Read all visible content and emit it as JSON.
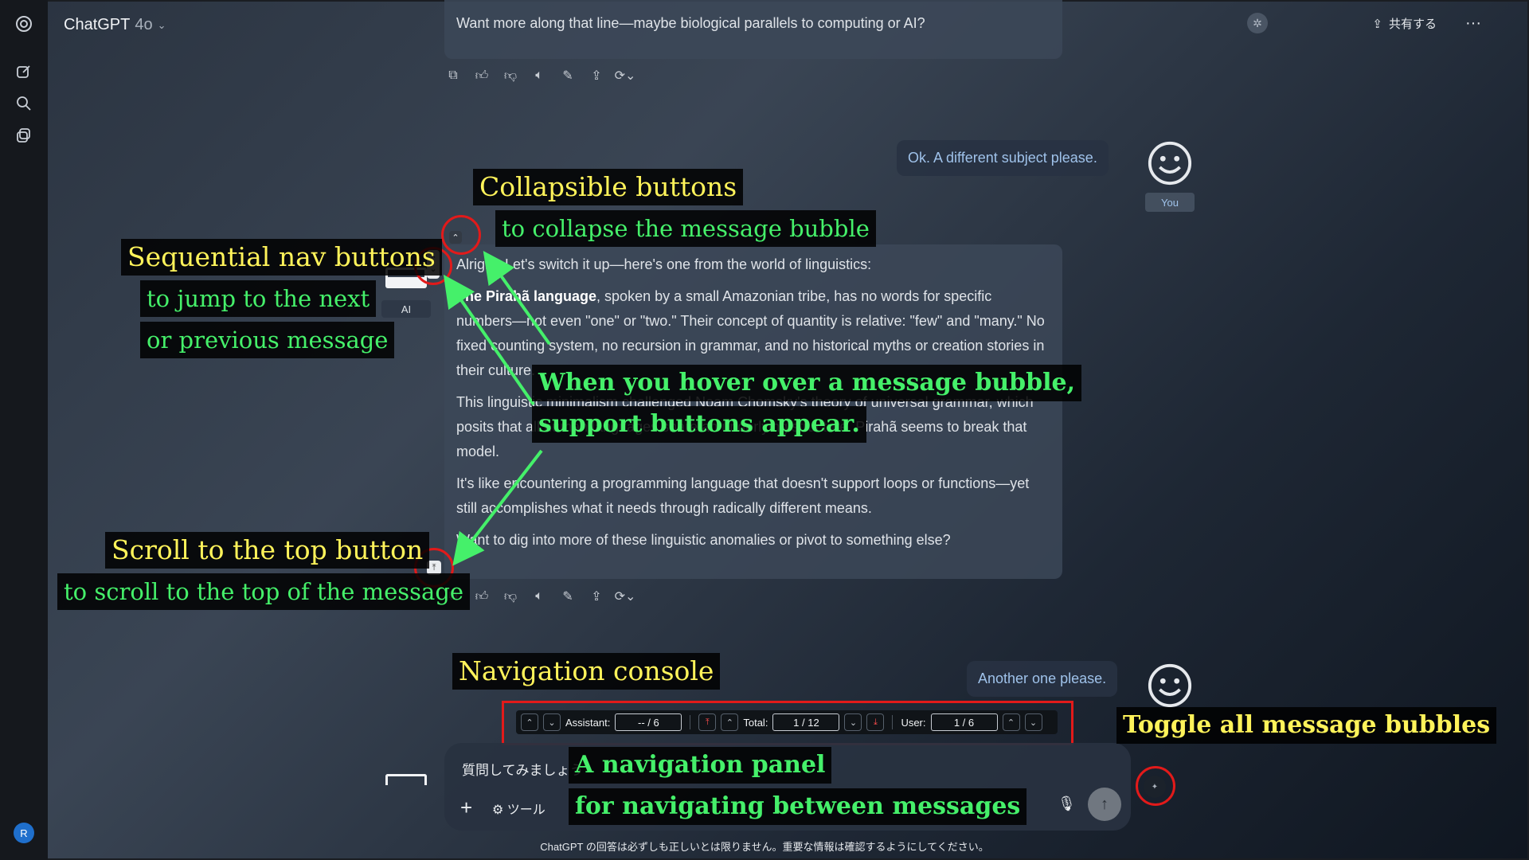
{
  "header": {
    "model_name": "ChatGPT",
    "model_version": "4o",
    "share_label": "共有する",
    "more_label": "···"
  },
  "sidebar": {
    "avatar_initial": "R"
  },
  "messages": {
    "prev_assistant_text": "Want more along that line—maybe biological parallels to computing or AI?",
    "user_1": "Ok. A different subject please.",
    "user_label": "You",
    "ai_label": "AI",
    "assistant": {
      "p1": "Alright. Let's switch it up—here's one from the world of linguistics:",
      "p2_bold": "The Pirahã language",
      "p2_rest": ", spoken by a small Amazonian tribe, has no words for specific numbers—not even \"one\" or \"two.\" Their concept of quantity is relative: \"few\" and \"many.\" No fixed counting system, no recursion in grammar, and no historical myths or creation stories in their culture.",
      "p3": "This linguistic minimalism challenged Noam Chomsky's theory of universal grammar, which posits that all human languages share an underlying structure. Pirahã seems to break that model.",
      "p4": "It's like encountering a programming language that doesn't support loops or functions—yet still accomplishes what it needs through radically different means.",
      "p5": "Want to dig into more of these linguistic anomalies or pivot to something else?"
    },
    "user_2": "Another one please."
  },
  "console": {
    "assistant_label": "Assistant:",
    "assistant_value": "-- / 6",
    "total_label": "Total:",
    "total_value": "1 / 12",
    "user_label": "User:",
    "user_value": "1 / 6"
  },
  "input": {
    "placeholder": "質問してみましょう",
    "tools_label": "ツール"
  },
  "disclaimer": "ChatGPT の回答は必ずしも正しいとは限りません。重要な情報は確認するようにしてください。",
  "annotations": {
    "collapsible_title": "Collapsible buttons",
    "collapsible_sub": "to collapse the message bubble",
    "seq_title": "Sequential nav buttons",
    "seq_sub1": "to jump to the next",
    "seq_sub2": "or previous message",
    "hover_1": "When you hover over a message bubble,",
    "hover_2": "support buttons appear.",
    "scroll_title": "Scroll to the top button",
    "scroll_sub": "to scroll to the top of the message",
    "nav_title": "Navigation console",
    "toggle": "Toggle all message bubbles",
    "panel_1": "A navigation panel",
    "panel_2": "for navigating between messages"
  },
  "colors": {
    "annotation_yellow": "#fff35a",
    "annotation_green": "#45f06a",
    "highlight_red": "#e21a1a"
  }
}
